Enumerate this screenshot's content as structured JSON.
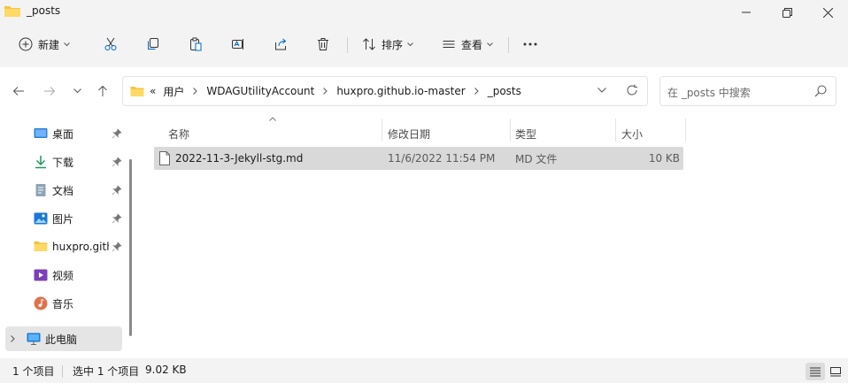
{
  "window": {
    "title": "_posts"
  },
  "toolbar": {
    "new_label": "新建",
    "sort_label": "排序",
    "view_label": "查看"
  },
  "address": {
    "overflow": "«",
    "crumbs": [
      "用户",
      "WDAGUtilityAccount",
      "huxpro.github.io-master",
      "_posts"
    ]
  },
  "search": {
    "placeholder": "在 _posts 中搜索"
  },
  "nav": {
    "items": [
      {
        "label": "桌面",
        "icon": "desktop-icon",
        "pinned": true
      },
      {
        "label": "下载",
        "icon": "download-icon",
        "pinned": true
      },
      {
        "label": "文档",
        "icon": "document-icon",
        "pinned": true
      },
      {
        "label": "图片",
        "icon": "picture-icon",
        "pinned": true
      },
      {
        "label": "huxpro.github.io-master",
        "icon": "folder-icon",
        "pinned": true
      },
      {
        "label": "视频",
        "icon": "video-icon",
        "pinned": false
      },
      {
        "label": "音乐",
        "icon": "music-icon",
        "pinned": false
      },
      {
        "label": "此电脑",
        "icon": "pc-icon",
        "pinned": false
      }
    ]
  },
  "columns": {
    "name": "名称",
    "modified": "修改日期",
    "type": "类型",
    "size": "大小"
  },
  "files": [
    {
      "name": "2022-11-3-Jekyll-stg.md",
      "modified": "11/6/2022 11:54 PM",
      "type": "MD 文件",
      "size": "10 KB"
    }
  ],
  "status": {
    "count": "1 个项目",
    "selected": "选中 1 个项目",
    "selected_size": "9.02 KB"
  },
  "colors": {
    "accent": "#0067c0",
    "folder": "#f4c542",
    "selected_row": "#d9d9d9"
  }
}
